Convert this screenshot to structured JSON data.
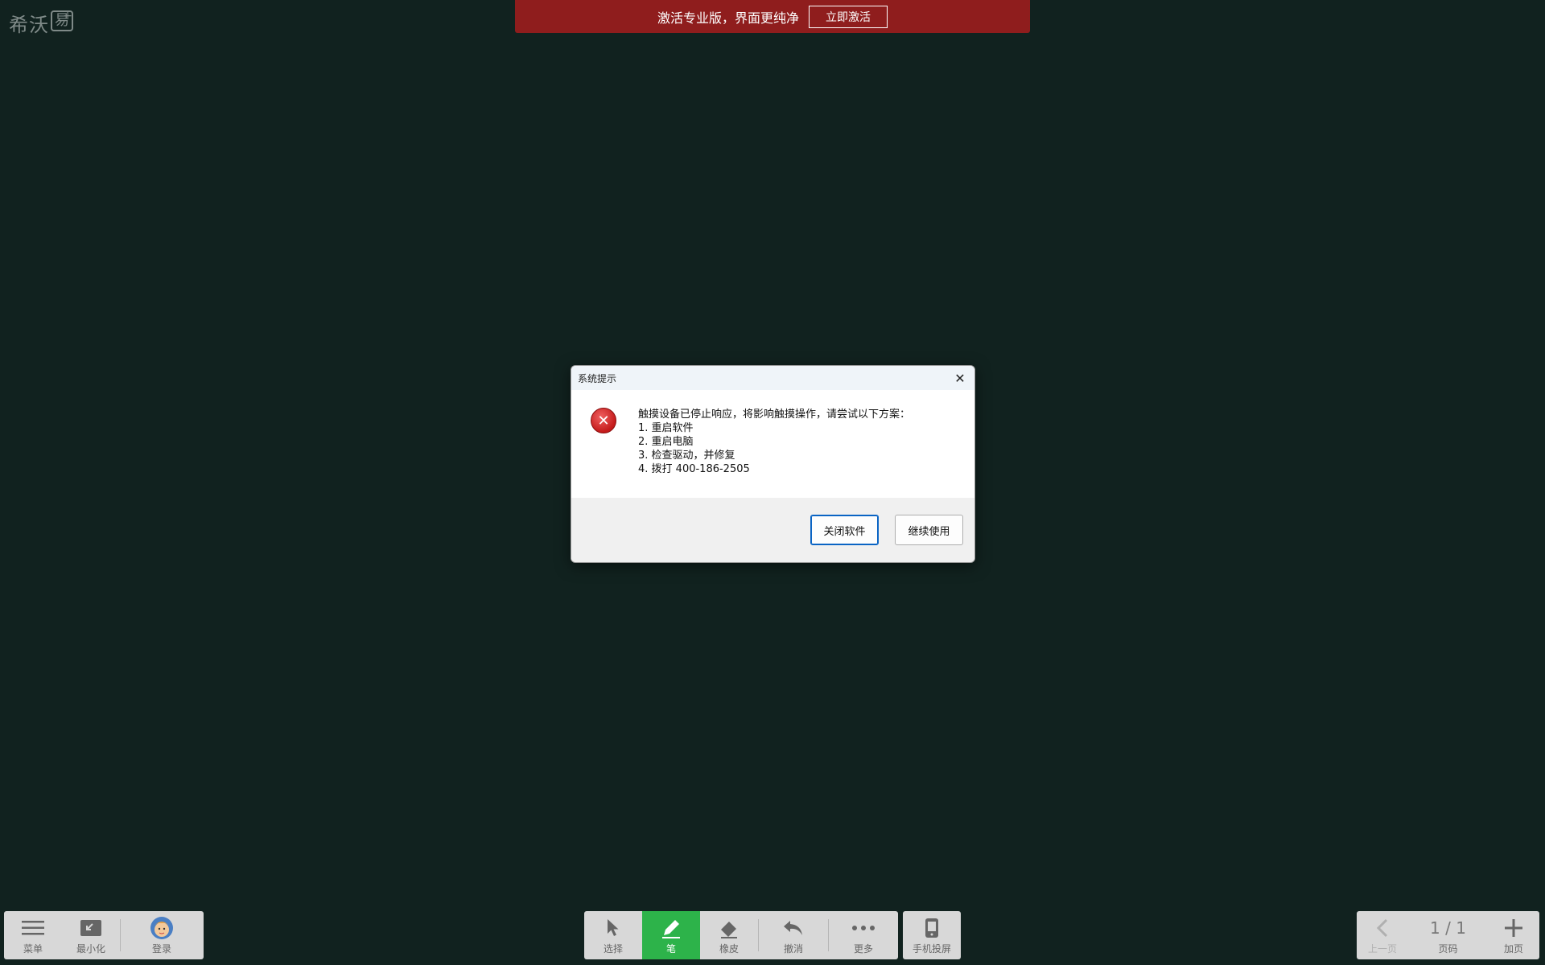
{
  "logo": {
    "text": "希沃",
    "box": "易",
    "plus": "+"
  },
  "banner": {
    "text": "激活专业版，界面更纯净",
    "button": "立即激活",
    "color": "#8f1d1d"
  },
  "dialog": {
    "title": "系统提示",
    "close": "✕",
    "icon": "error-icon",
    "lines": [
      "触摸设备已停止响应，将影响触摸操作，请尝试以下方案：",
      "1. 重启软件",
      "2. 重启电脑",
      "3. 检查驱动，并修复",
      "4. 拨打 400-186-2505"
    ],
    "buttons": {
      "close_app": "关闭软件",
      "continue": "继续使用"
    }
  },
  "left_toolbar": {
    "menu": "菜单",
    "minimize": "最小化",
    "login": "登录"
  },
  "main_toolbar": {
    "select": "选择",
    "pen": "笔",
    "eraser": "橡皮",
    "undo": "撤消",
    "more": "更多",
    "accent": "#2db34a"
  },
  "phone_toolbar": {
    "cast": "手机投屏"
  },
  "pager": {
    "prev": "上一页",
    "current": "1 / 1",
    "label": "页码",
    "add": "加页"
  }
}
